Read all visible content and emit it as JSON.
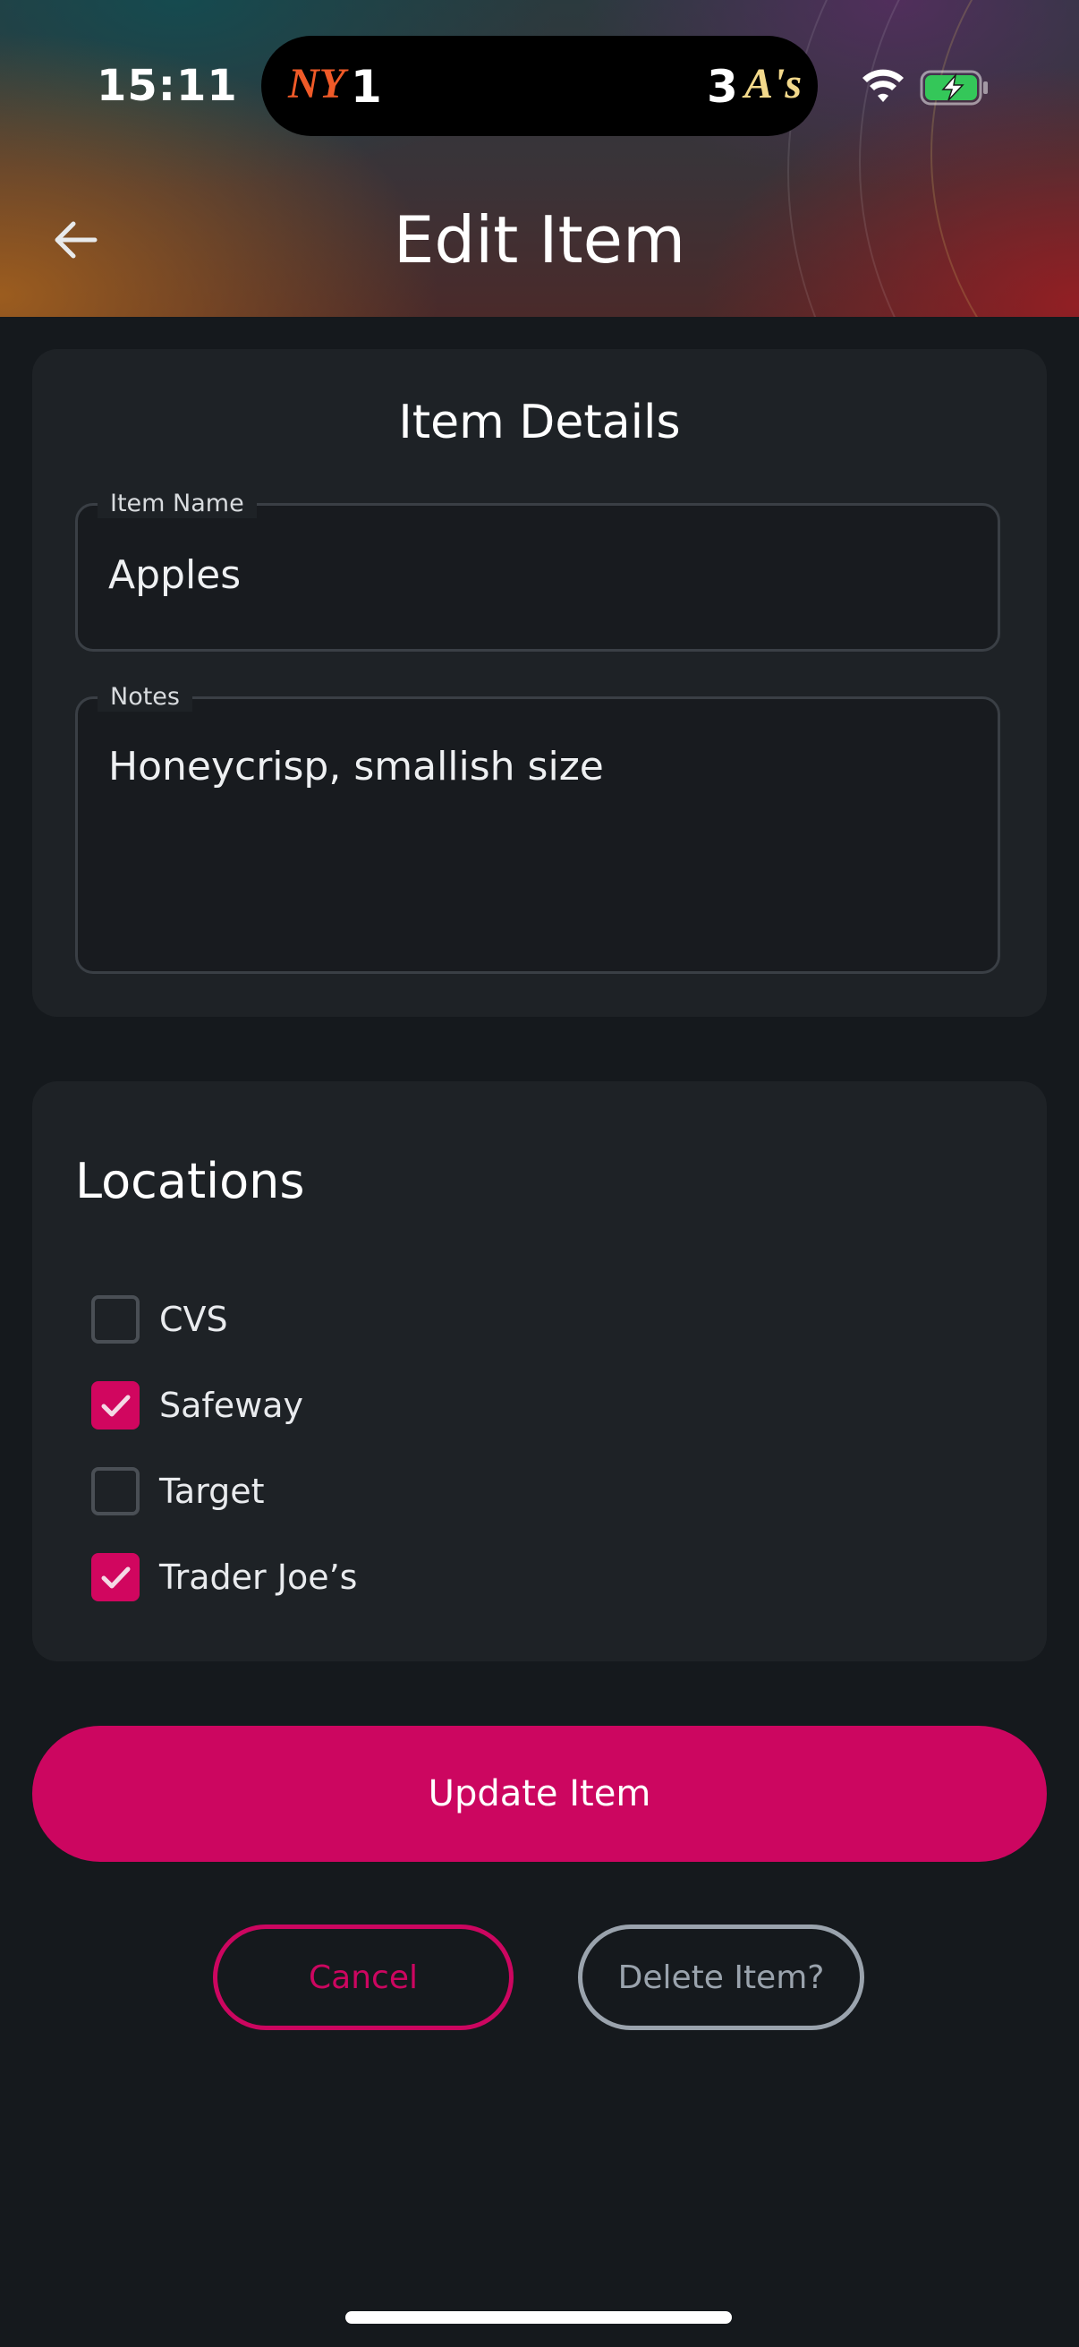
{
  "status_bar": {
    "time": "15:11",
    "live_activity": {
      "home_team": "NY",
      "home_score": "1",
      "away_score": "3",
      "away_team": "A's",
      "home_color": "#f05a28",
      "away_color": "#f3d98b"
    },
    "icons": [
      "wifi-icon",
      "battery-charging-icon"
    ]
  },
  "header": {
    "title": "Edit Item",
    "back_icon": "arrow-left-icon"
  },
  "details": {
    "title": "Item Details",
    "item_name_label": "Item Name",
    "item_name_value": "Apples",
    "notes_label": "Notes",
    "notes_value": "Honeycrisp, smallish size"
  },
  "locations": {
    "title": "Locations",
    "items": [
      {
        "label": "CVS",
        "checked": false
      },
      {
        "label": "Safeway",
        "checked": true
      },
      {
        "label": "Target",
        "checked": false
      },
      {
        "label": "Trader Joe’s",
        "checked": true
      }
    ]
  },
  "actions": {
    "update_label": "Update Item",
    "cancel_label": "Cancel",
    "delete_label": "Delete Item?"
  },
  "colors": {
    "accent": "#cc0660",
    "background": "#15191d",
    "card": "#1e2226",
    "muted_outline": "#9aa3ad"
  }
}
